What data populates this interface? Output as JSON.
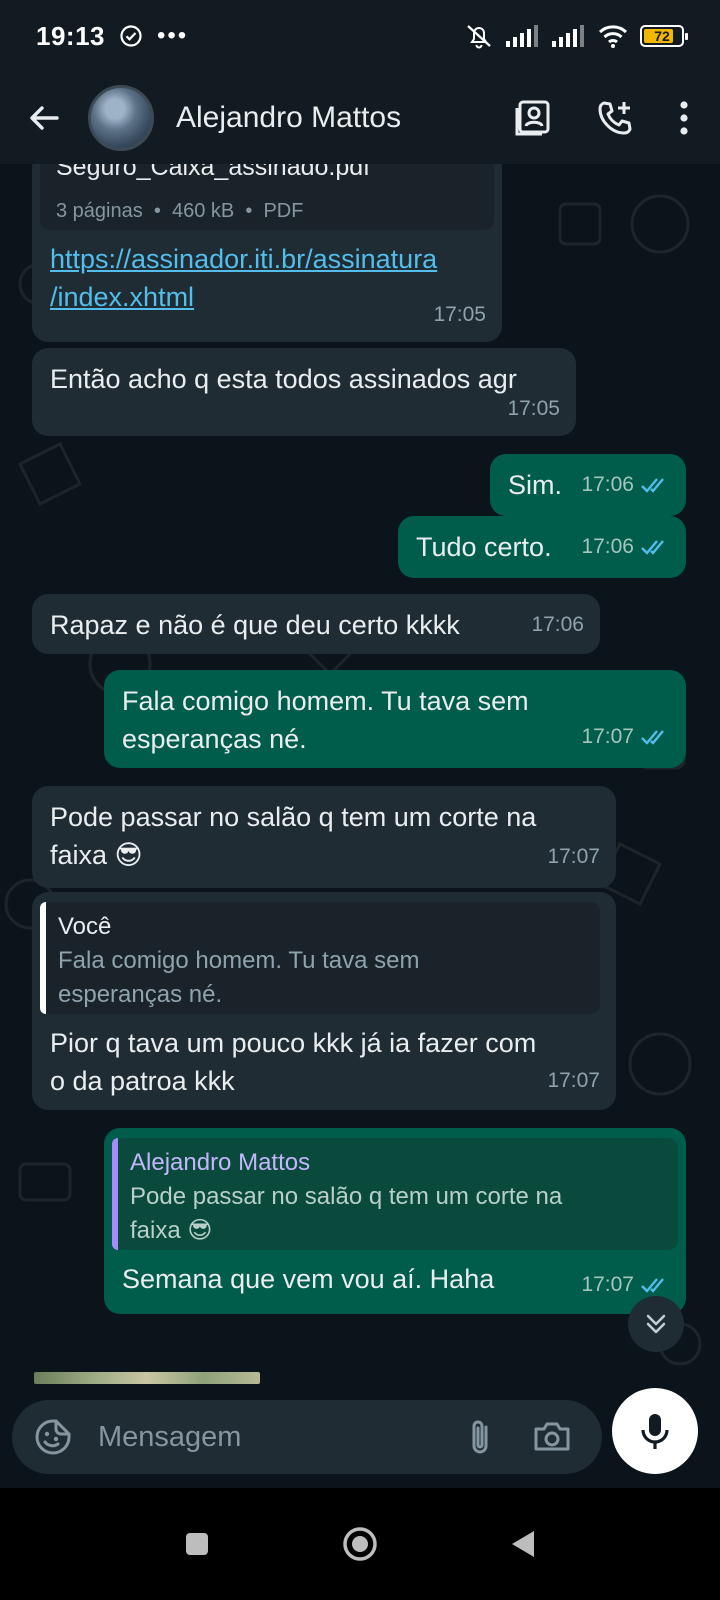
{
  "status_bar": {
    "time": "19:13",
    "battery_level": "72"
  },
  "header": {
    "contact_name": "Alejandro Mattos"
  },
  "messages": [
    {
      "direction": "in",
      "file_name": "Seguro_Caixa_assinado.pdf",
      "file_meta": "3 páginas  •  460 kB  •  PDF",
      "link_line1": "https://assinador.iti.br/assinatura",
      "link_line2": "/index.xhtml",
      "time": "17:05"
    },
    {
      "direction": "in",
      "text": "Então acho q esta todos assinados agr",
      "time": "17:05"
    },
    {
      "direction": "out",
      "text": "Sim.",
      "time": "17:06"
    },
    {
      "direction": "out",
      "text": "Tudo certo.",
      "time": "17:06"
    },
    {
      "direction": "in",
      "text": "Rapaz e não é que deu certo kkkk",
      "time": "17:06"
    },
    {
      "direction": "out",
      "line1": "Fala comigo homem. Tu tava sem",
      "line2": "esperanças né.",
      "time": "17:07"
    },
    {
      "direction": "in",
      "line1": "Pode passar no salão q tem um corte na",
      "line2": "faixa 😎",
      "time": "17:07"
    },
    {
      "direction": "in",
      "quote_name": "Você",
      "quote_line1": "Fala comigo homem. Tu tava sem",
      "quote_line2": "esperanças né.",
      "line1": "Pior q tava um pouco kkk já ia fazer com",
      "line2": "o da patroa kkk",
      "time": "17:07"
    },
    {
      "direction": "out",
      "quote_name": "Alejandro Mattos",
      "quote_line1": "Pode passar no salão q tem um corte na",
      "quote_line2": "faixa 😎",
      "text": "Semana que vem vou aí. Haha",
      "time": "17:07"
    }
  ],
  "composer": {
    "placeholder": "Mensagem"
  },
  "colors": {
    "incoming_bubble": "#202c33",
    "outgoing_bubble": "#005c4b",
    "read_ticks": "#53bdeb",
    "link": "#53bdeb"
  },
  "icons": [
    "back-arrow-icon",
    "contact-card-icon",
    "add-call-icon",
    "more-vert-icon",
    "sticker-icon",
    "attach-icon",
    "camera-icon",
    "mic-icon",
    "scroll-down-icon"
  ]
}
